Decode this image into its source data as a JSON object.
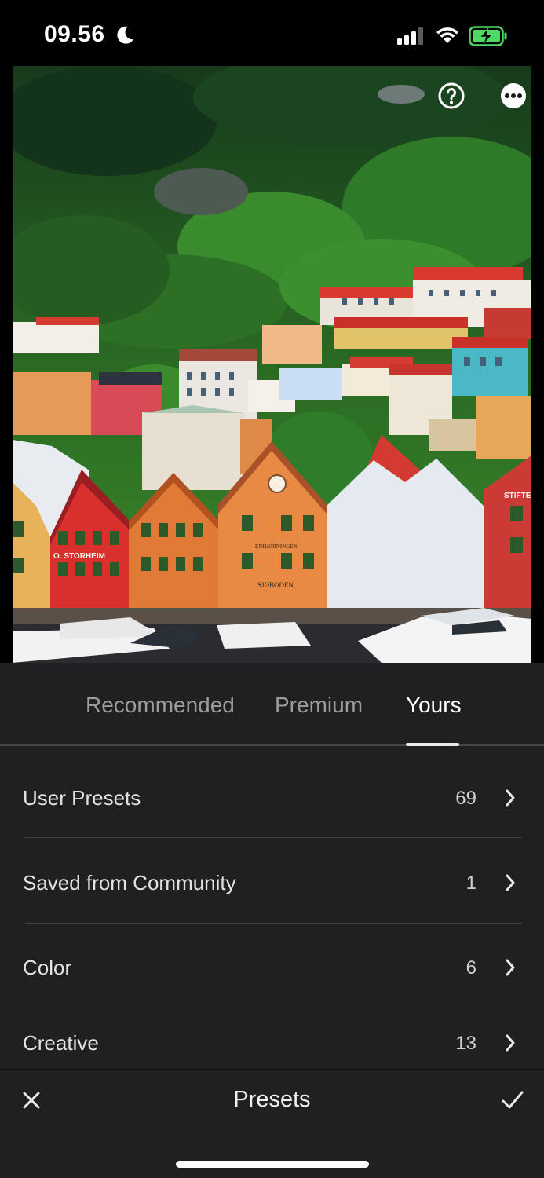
{
  "status_bar": {
    "time": "09.56"
  },
  "photo": {
    "house_signs": [
      "O. STORHEIM",
      "SJØBODEN",
      "ENHJØRNINGEN",
      "STIFTE"
    ]
  },
  "tabs": [
    {
      "label": "Recommended",
      "active": false
    },
    {
      "label": "Premium",
      "active": false
    },
    {
      "label": "Yours",
      "active": true
    }
  ],
  "presets": [
    {
      "label": "User Presets",
      "count": "69"
    },
    {
      "label": "Saved from Community",
      "count": "1"
    },
    {
      "label": "Color",
      "count": "6"
    },
    {
      "label": "Creative",
      "count": "13"
    }
  ],
  "bottom_bar": {
    "title": "Presets"
  },
  "colors": {
    "panel_bg": "#202022",
    "text_primary": "#ffffff",
    "text_inactive": "#9c9c9e",
    "battery_fill": "#4cd964"
  }
}
